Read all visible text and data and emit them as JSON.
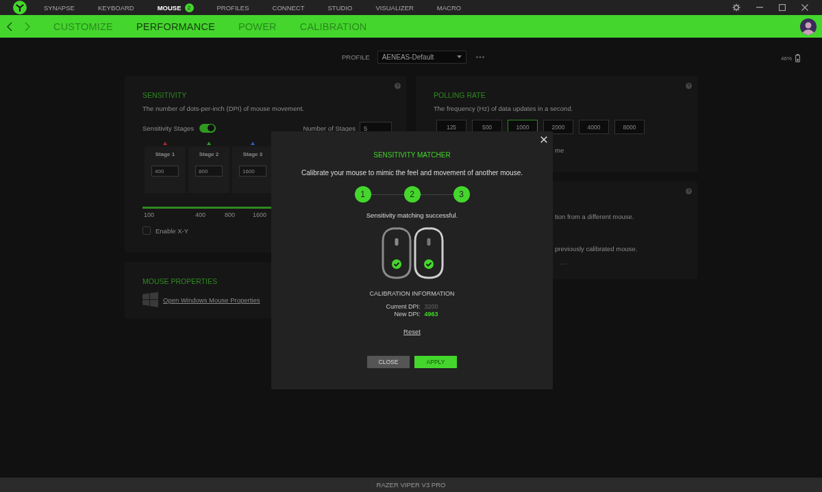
{
  "title_bar": {
    "tabs": [
      {
        "label": "SYNAPSE",
        "selected": false
      },
      {
        "label": "KEYBOARD",
        "selected": false
      },
      {
        "label": "MOUSE",
        "selected": true,
        "badge": "2"
      },
      {
        "label": "PROFILES",
        "selected": false
      },
      {
        "label": "CONNECT",
        "selected": false
      },
      {
        "label": "STUDIO",
        "selected": false
      },
      {
        "label": "VISUALIZER",
        "selected": false
      },
      {
        "label": "MACRO",
        "selected": false
      }
    ]
  },
  "nav": {
    "tabs": [
      {
        "label": "CUSTOMIZE",
        "selected": false
      },
      {
        "label": "PERFORMANCE",
        "selected": true
      },
      {
        "label": "POWER",
        "selected": false
      },
      {
        "label": "CALIBRATION",
        "selected": false
      }
    ]
  },
  "profile": {
    "label": "PROFILE",
    "value": "AENEAS-Default"
  },
  "battery": {
    "reading": "46%"
  },
  "sensitivity": {
    "title": "SENSITIVITY",
    "description": "The number of dots-per-inch (DPI) of mouse movement.",
    "stages_label": "Sensitivity Stages",
    "stages_on": true,
    "count_label": "Number of Stages",
    "count": "5",
    "stages": [
      {
        "label": "Stage 1",
        "value": "400",
        "color": "#b3252a"
      },
      {
        "label": "Stage 2",
        "value": "800",
        "color": "#2f9a26"
      },
      {
        "label": "Stage 3",
        "value": "1600",
        "color": "#2a5fb8"
      }
    ],
    "ticks": [
      "100",
      "400",
      "800",
      "1600"
    ],
    "enable_xy": {
      "label": "Enable X-Y",
      "checked": false
    }
  },
  "mouse_properties": {
    "title": "MOUSE PROPERTIES",
    "link": "Open Windows Mouse Properties"
  },
  "polling": {
    "title": "POLLING RATE",
    "description": "The frequency (Hz) of data updates in a second.",
    "rates": [
      {
        "label": "125",
        "selected": false
      },
      {
        "label": "500",
        "selected": false
      },
      {
        "label": "1000",
        "selected": true
      },
      {
        "label": "2000",
        "selected": false
      },
      {
        "label": "4000",
        "selected": false
      },
      {
        "label": "8000",
        "selected": false
      }
    ],
    "partial_line": "me"
  },
  "calibration_card": {
    "lines": [
      "tion from a different mouse.",
      "previously calibrated mouse."
    ]
  },
  "modal": {
    "title": "SENSITIVITY MATCHER",
    "description": "Calibrate your mouse to mimic the feel and movement of another mouse.",
    "steps": [
      {
        "label": "1",
        "done": true
      },
      {
        "label": "2",
        "done": true
      },
      {
        "label": "3",
        "done": true
      }
    ],
    "message": "Sensitivity matching successful.",
    "info_title": "CALIBRATION INFORMATION",
    "current_label": "Current DPI:",
    "current_value": "3200",
    "new_label": "New DPI:",
    "new_value": "4963",
    "reset": "Reset",
    "close_button": "CLOSE",
    "apply_button": "APPLY"
  },
  "status_bar": {
    "device": "RAZER VIPER V3 PRO"
  }
}
